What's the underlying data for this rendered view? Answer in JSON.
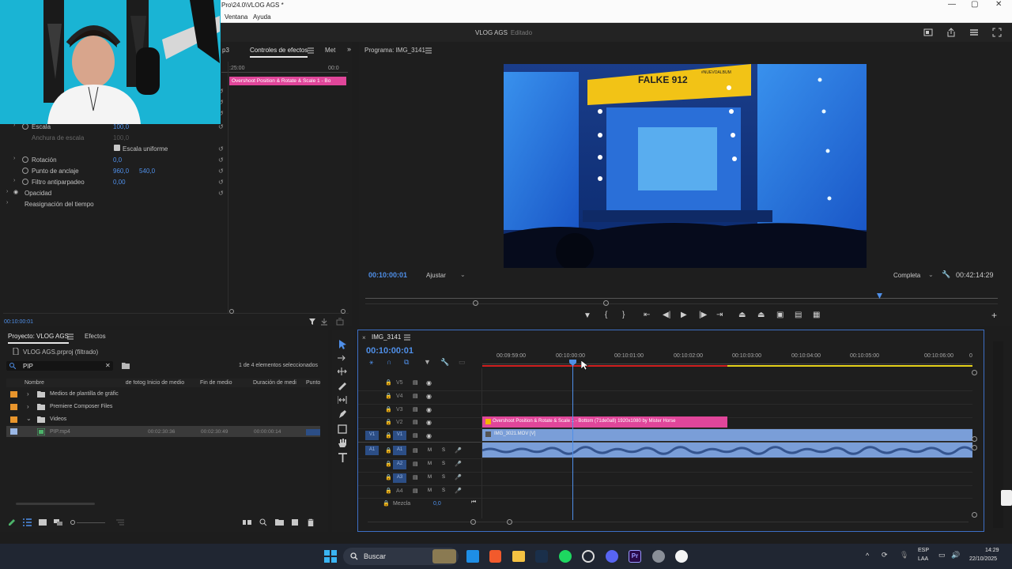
{
  "window": {
    "title": "Pro\\24.0\\VLOG AGS *",
    "menu": [
      "Ventana",
      "Ayuda"
    ]
  },
  "header": {
    "project_name": "VLOG AGS",
    "status": "Editado"
  },
  "effects_panel": {
    "tab_partial": "p3",
    "tab_active": "Controles de efectos",
    "tab_next": "Met",
    "ruler_start": ":25:00",
    "ruler_end": "00:0",
    "clip_bar": "Overshoot Position & Rotate & Scale 1 - Bo",
    "properties": [
      {
        "label": "Escala",
        "value": "100,0",
        "value2": ""
      },
      {
        "label": "Anchura de escala",
        "value": "100,0",
        "value2": ""
      },
      {
        "label": "Rotación",
        "value": "0,0",
        "value2": ""
      },
      {
        "label": "Punto de anclaje",
        "value": "960,0",
        "value2": "540,0"
      },
      {
        "label": "Filtro antiparpadeo",
        "value": "0,00",
        "value2": ""
      },
      {
        "label": "Opacidad",
        "value": "",
        "value2": ""
      },
      {
        "label": "Reasignación del tiempo",
        "value": "",
        "value2": ""
      }
    ],
    "checkbox_label": "Escala uniforme",
    "timecode": "00:10:00:01"
  },
  "program": {
    "title": "Programa: IMG_3141",
    "timecode": "00:10:00:01",
    "fit": "Ajustar",
    "quality": "Completa",
    "duration": "00:42:14:29",
    "video_banner": "FALKE 912",
    "video_tag": "#NUEVOALBUM"
  },
  "project": {
    "tab_active": "Proyecto: VLOG AGS",
    "tab_other": "Efectos",
    "file": "VLOG AGS.prproj (filtrado)",
    "search": "PIP",
    "selection": "1 de 4 elementos seleccionados",
    "columns": [
      "Nombre",
      "Velocidad de fotog",
      "Inicio de medio",
      "Fin de medio",
      "Duración de medi",
      "Punto"
    ],
    "items": [
      {
        "name": "Medios de plantilla de gráfic",
        "start": "",
        "end": "",
        "dur": ""
      },
      {
        "name": "Premiere Composer Files",
        "start": "",
        "end": "",
        "dur": ""
      },
      {
        "name": "Videos",
        "start": "",
        "end": "",
        "dur": ""
      },
      {
        "name": "PIP.mp4",
        "start": "00:02:30:36",
        "end": "00:02:30:49",
        "dur": "00:00:00:14"
      }
    ]
  },
  "timeline": {
    "title": "IMG_3141",
    "timecode": "00:10:00:01",
    "ruler": [
      "00:09:59:00",
      "00:10:00:00",
      "00:10:01:00",
      "00:10:02:00",
      "00:10:03:00",
      "00:10:04:00",
      "00:10:05:00",
      "00:10:06:00"
    ],
    "ruler_end": "0",
    "video_tracks": [
      "V5",
      "V4",
      "V3",
      "V2",
      "V1"
    ],
    "audio_tracks": [
      "A1",
      "A2",
      "A3",
      "A4"
    ],
    "mix_label": "Mezcla",
    "mix_value": "0,0",
    "clip_pink": "Overshoot Position & Rotate & Scale 1 - Bottom (71de0a8) 1920x1080 by Mister Horse",
    "clip_video": "IMG_3021.MOV [V]",
    "source_v": "V1",
    "source_a": "A1"
  },
  "taskbar": {
    "search": "Buscar",
    "lang1": "ESP",
    "lang2": "LAA",
    "time": "14:29",
    "date": "22/10/2025"
  }
}
